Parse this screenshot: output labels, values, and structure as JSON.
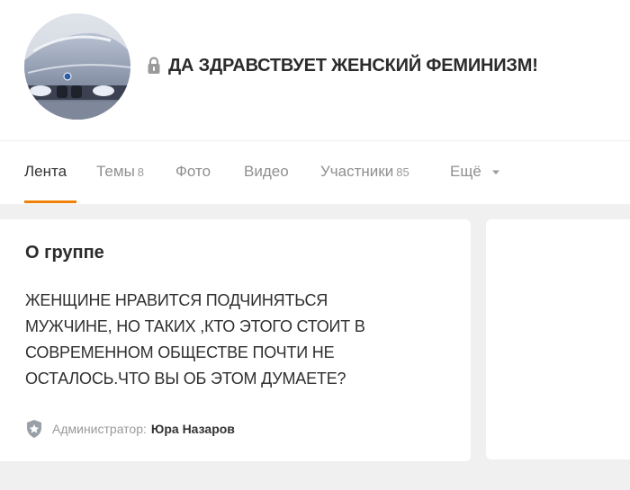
{
  "group": {
    "title": "ДА ЗДРАВСТВУЕТ ЖЕНСКИЙ ФЕМИНИЗМ!",
    "avatar_icon": "car-photo",
    "lock_icon": "lock-icon"
  },
  "tabs": [
    {
      "label": "Лента",
      "count": "",
      "active": true
    },
    {
      "label": "Темы",
      "count": "8",
      "active": false
    },
    {
      "label": "Фото",
      "count": "",
      "active": false
    },
    {
      "label": "Видео",
      "count": "",
      "active": false
    },
    {
      "label": "Участники",
      "count": "85",
      "active": false
    },
    {
      "label": "Ещё",
      "count": "",
      "active": false
    }
  ],
  "about": {
    "heading": "О группе",
    "lines": [
      "ЖЕНЩИНЕ НРАВИТСЯ ПОДЧИНЯТЬСЯ",
      "МУЖЧИНЕ, НО ТАКИХ ,КТО ЭТОГО СТОИТ В",
      "СОВРЕМЕННОМ ОБЩЕСТВЕ ПОЧТИ НЕ",
      "ОСТАЛОСЬ.ЧТО ВЫ ОБ ЭТОМ ДУМАЕТЕ?"
    ],
    "admin_label": "Администратор:",
    "admin_name": "Юра Назаров"
  },
  "colors": {
    "accent": "#ee8208",
    "background": "#f0f0f0",
    "card": "#ffffff"
  }
}
